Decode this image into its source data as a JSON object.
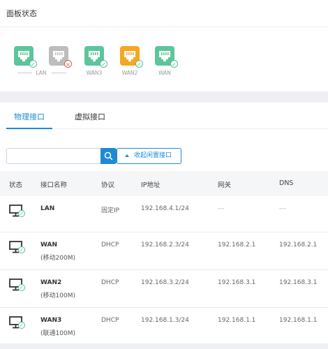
{
  "panel": {
    "title": "面板状态"
  },
  "ports": [
    {
      "status": "ok",
      "color": "#5cc59b"
    },
    {
      "status": "error",
      "color": "#bdbdbd"
    },
    {
      "status": "ok",
      "color": "#5cc59b"
    },
    {
      "status": "ok",
      "color": "#f5a623"
    },
    {
      "status": "ok",
      "color": "#5cc59b"
    }
  ],
  "port_labels": {
    "lan": "LAN",
    "wan3": "WAN3",
    "wan2": "WAN2",
    "wan": "WAN"
  },
  "tabs": [
    {
      "label": "物理接口",
      "active": true
    },
    {
      "label": "虚拟接口",
      "active": false
    }
  ],
  "search": {
    "placeholder": "",
    "value": ""
  },
  "collapse_button": {
    "label": "收起闲置接口"
  },
  "table": {
    "headers": {
      "status": "状态",
      "name": "接口名称",
      "protocol": "协议",
      "ip": "IP地址",
      "gateway": "网关",
      "dns": "DNS"
    },
    "rows": [
      {
        "name": "LAN",
        "sub": "",
        "protocol": "固定IP",
        "ip": "192.168.4.1/24",
        "gateway": "---",
        "dns": "---"
      },
      {
        "name": "WAN",
        "sub": "(移动200M)",
        "protocol": "DHCP",
        "ip": "192.168.2.3/24",
        "gateway": "192.168.2.1",
        "dns": "192.168.2.1"
      },
      {
        "name": "WAN2",
        "sub": "(移动100M)",
        "protocol": "DHCP",
        "ip": "192.168.3.2/24",
        "gateway": "192.168.3.1",
        "dns": "192.168.3.1"
      },
      {
        "name": "WAN3",
        "sub": "(联通100M)",
        "protocol": "DHCP",
        "ip": "192.168.1.3/24",
        "gateway": "192.168.1.1",
        "dns": "192.168.1.1"
      }
    ]
  },
  "colors": {
    "accent": "#1e8ad6",
    "ok": "#52c08f",
    "error": "#e05a5a"
  }
}
